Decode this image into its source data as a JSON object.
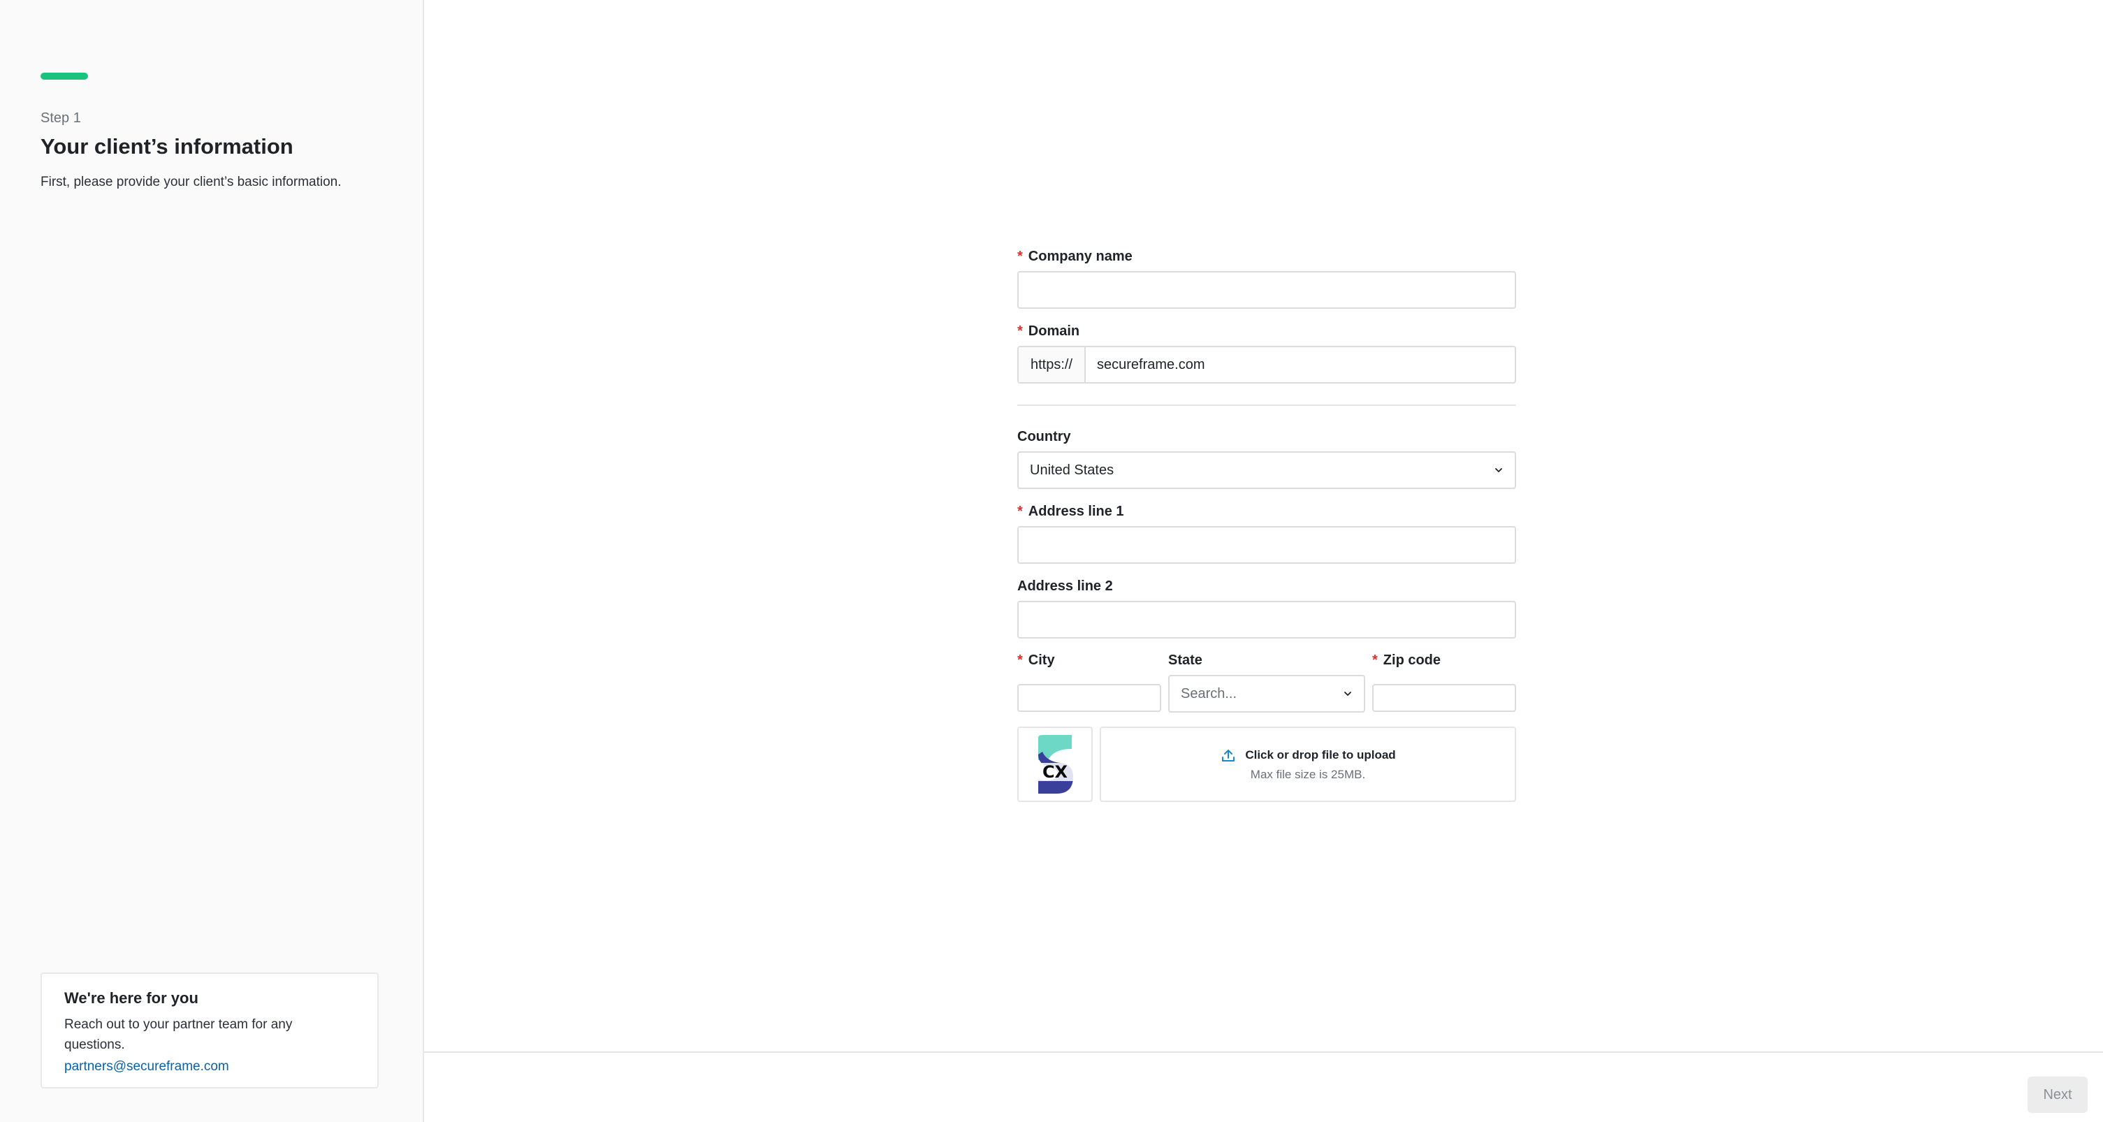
{
  "sidebar": {
    "step_label": "Step 1",
    "title": "Your client’s information",
    "description": "First, please provide your client’s basic information.",
    "help": {
      "title": "We're here for you",
      "text": "Reach out to your partner team for any questions.",
      "email": "partners@secureframe.com"
    }
  },
  "form": {
    "company_name": {
      "label": "Company name",
      "value": ""
    },
    "domain": {
      "label": "Domain",
      "prefix": "https://",
      "value": "secureframe.com"
    },
    "country": {
      "label": "Country",
      "value": "United States"
    },
    "address1": {
      "label": "Address line 1",
      "value": ""
    },
    "address2": {
      "label": "Address line 2",
      "value": ""
    },
    "city": {
      "label": "City",
      "value": ""
    },
    "state": {
      "label": "State",
      "placeholder": "Search..."
    },
    "zip": {
      "label": "Zip code",
      "value": ""
    },
    "upload": {
      "title": "Click or drop file to upload",
      "subtitle": "Max file size is 25MB.",
      "logo_text": "CX"
    },
    "required_mark": "*"
  },
  "footer": {
    "next_label": "Next"
  },
  "colors": {
    "accent": "#19c37d",
    "link": "#0b61a4",
    "required": "#e0302e",
    "upload_icon": "#1a88c9"
  }
}
